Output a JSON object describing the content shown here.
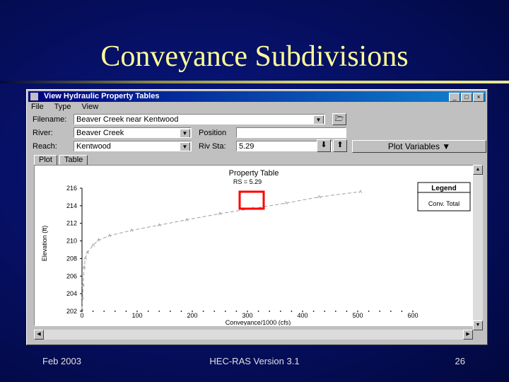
{
  "slide": {
    "title": "Conveyance Subdivisions",
    "footer_left": "Feb 2003",
    "footer_center": "HEC-RAS Version 3.1",
    "footer_right": "26"
  },
  "window": {
    "title": "View Hydraulic Property Tables",
    "menu": [
      "File",
      "Type",
      "View"
    ],
    "controls": {
      "minimize": "_",
      "maximize": "□",
      "close": "×"
    }
  },
  "form": {
    "filename_label": "Filename:",
    "filename_value": "Beaver Creek near Kentwood",
    "river_label": "River:",
    "river_value": "Beaver Creek",
    "position_label": "Position",
    "position_value": "",
    "reach_label": "Reach:",
    "reach_value": "Kentwood",
    "rivsta_label": "Riv Sta:",
    "rivsta_value": "5.29",
    "plot_variables_label": "Plot Variables ▼",
    "down_arrow": "⬇",
    "up_arrow": "⬆"
  },
  "tabs": [
    "Plot",
    "Table"
  ],
  "chart_data": {
    "type": "line",
    "title": "Property Table",
    "subtitle": "RS = 5.29",
    "xlabel": "Conveyance/1000 (cfs)",
    "ylabel": "Elevation (ft)",
    "xlim": [
      0,
      600
    ],
    "ylim": [
      202,
      216
    ],
    "x_ticks": [
      "0",
      "100",
      "200",
      "300",
      "400",
      "500",
      "600"
    ],
    "y_ticks": [
      "202",
      "204",
      "206",
      "208",
      "210",
      "212",
      "214",
      "216"
    ],
    "legend_title": "Legend",
    "legend_placement": "top-right",
    "series": [
      {
        "name": "Conv. Total",
        "color": "#a0a0a0",
        "points": [
          [
            0,
            202.2
          ],
          [
            1,
            203.5
          ],
          [
            2,
            205
          ],
          [
            4,
            207
          ],
          [
            6,
            208
          ],
          [
            10,
            208.7
          ],
          [
            20,
            209.5
          ],
          [
            30,
            210.1
          ],
          [
            50,
            210.6
          ],
          [
            90,
            211.2
          ],
          [
            140,
            211.8
          ],
          [
            190,
            212.4
          ],
          [
            250,
            213.1
          ],
          [
            310,
            213.7
          ],
          [
            370,
            214.3
          ],
          [
            430,
            215.0
          ],
          [
            505,
            215.6
          ]
        ]
      }
    ],
    "highlight_note": "red box marker"
  }
}
